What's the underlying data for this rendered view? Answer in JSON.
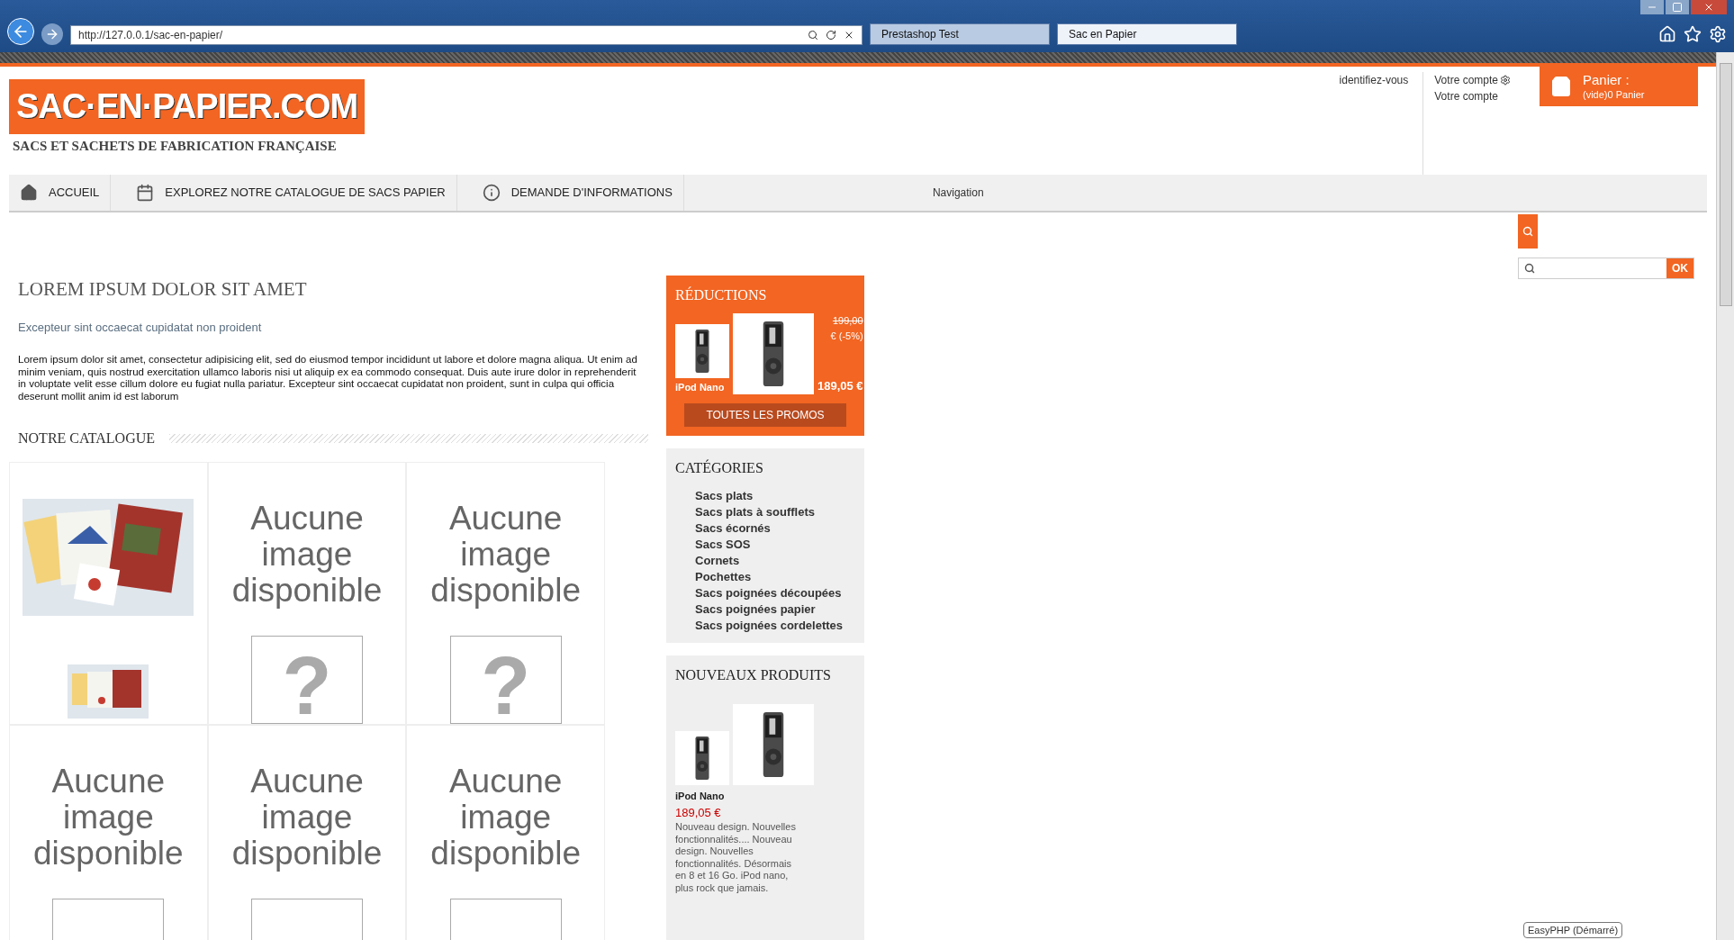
{
  "browser": {
    "address": "http://127.0.0.1/sac-en-papier/",
    "tabs": [
      {
        "label": "Prestashop Test",
        "selected": false
      },
      {
        "label": "Sac en Papier",
        "selected": true
      }
    ]
  },
  "header": {
    "logo": "SAC·EN·PAPIER.COM",
    "tagline": "SACS ET SACHETS DE FABRICATION FRANÇAISE",
    "login": "identifiez-vous",
    "account": "Votre compte",
    "account_2": "Votre compte",
    "cart_title": "Panier :",
    "cart_status": "(vide)0 Panier"
  },
  "nav": {
    "items": [
      {
        "label": "ACCUEIL"
      },
      {
        "label": "EXPLOREZ NOTRE CATALOGUE DE SACS PAPIER"
      },
      {
        "label": "DEMANDE D'INFORMATIONS"
      }
    ],
    "label": "Navigation"
  },
  "search": {
    "button": "OK"
  },
  "intro": {
    "title": "LOREM IPSUM DOLOR SIT AMET",
    "subtitle": "Excepteur sint occaecat cupidatat non proident",
    "text": "Lorem ipsum dolor sit amet, consectetur adipisicing elit, sed do eiusmod tempor incididunt ut labore et dolore magna aliqua. Ut enim ad minim veniam, quis nostrud exercitation ullamco laboris nisi ut aliquip ex ea commodo consequat. Duis aute irure dolor in reprehenderit in voluptate velit esse cillum dolore eu fugiat nulla pariatur. Excepteur sint occaecat cupidatat non proident, sunt in culpa qui officia deserunt mollit anim id est laborum"
  },
  "catalogue": {
    "title": "NOTRE CATALOGUE",
    "products": [
      {
        "kind": "picture"
      },
      {
        "kind": "placeholder",
        "text": "Aucune image disponible",
        "mark": "?"
      },
      {
        "kind": "placeholder",
        "text": "Aucune image disponible",
        "mark": "?"
      },
      {
        "kind": "placeholder",
        "text": "Aucune image disponible"
      },
      {
        "kind": "placeholder",
        "text": "Aucune image disponible"
      },
      {
        "kind": "placeholder",
        "text": "Aucune image disponible"
      }
    ]
  },
  "reductions": {
    "title": "RÉDUCTIONS",
    "old_price": "199,00",
    "discount": "€ (-5%)",
    "product": "iPod Nano",
    "price": "189,05 €",
    "button": "TOUTES LES PROMOS"
  },
  "categories": {
    "title": "CATÉGORIES",
    "items": [
      "Sacs plats",
      "Sacs plats à soufflets",
      "Sacs écornés",
      "Sacs SOS",
      "Cornets",
      "Pochettes",
      "Sacs poignées découpées",
      "Sacs poignées papier",
      "Sacs poignées cordelettes"
    ]
  },
  "new_products": {
    "title": "NOUVEAUX PRODUITS",
    "product": "iPod Nano",
    "price": "189,05 €",
    "description": "Nouveau design. Nouvelles fonctionnalités.... Nouveau design. Nouvelles fonctionnalités. Désormais en 8 et 16 Go. iPod nano, plus rock que jamais."
  },
  "tooltip": "EasyPHP (Démarré)"
}
